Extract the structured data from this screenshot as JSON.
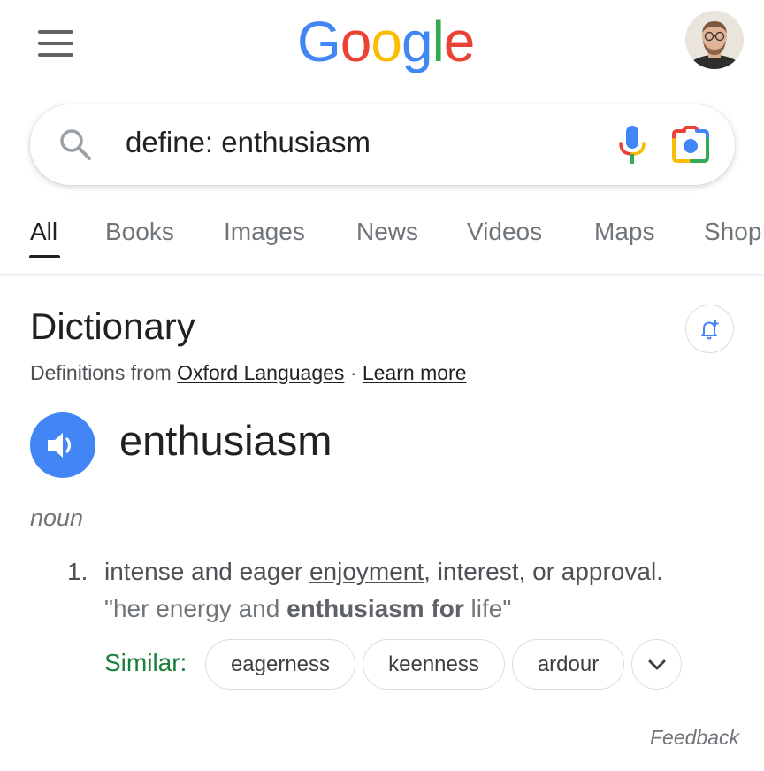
{
  "header": {
    "logo_letters": [
      {
        "char": "G",
        "color": "#4285F4"
      },
      {
        "char": "o",
        "color": "#EA4335"
      },
      {
        "char": "o",
        "color": "#FBBC05"
      },
      {
        "char": "g",
        "color": "#4285F4"
      },
      {
        "char": "l",
        "color": "#34A853"
      },
      {
        "char": "e",
        "color": "#EA4335"
      }
    ],
    "menu_icon": "hamburger-menu-icon",
    "avatar_icon": "user-avatar"
  },
  "search": {
    "query": "define: enthusiasm",
    "search_icon": "search-icon",
    "voice_icon": "microphone-icon",
    "lens_icon": "google-lens-icon"
  },
  "tabs": [
    {
      "label": "All",
      "active": true
    },
    {
      "label": "Books",
      "active": false
    },
    {
      "label": "Images",
      "active": false
    },
    {
      "label": "News",
      "active": false
    },
    {
      "label": "Videos",
      "active": false
    },
    {
      "label": "Maps",
      "active": false
    },
    {
      "label": "Shop",
      "active": false
    }
  ],
  "dictionary": {
    "title": "Dictionary",
    "source_prefix": "Definitions from",
    "source_link": "Oxford Languages",
    "separator": "·",
    "learn_more": "Learn more",
    "alert_icon": "bell-plus-icon",
    "speaker_icon": "speaker-icon",
    "word": "enthusiasm",
    "part_of_speech": "noun",
    "definitions": [
      {
        "number": "1.",
        "text_before": "intense and eager ",
        "link_word": "enjoyment",
        "text_after": ", interest, or approval.",
        "example_before": "\"her energy and ",
        "example_bold": "enthusiasm for",
        "example_after": " life\""
      }
    ],
    "similar_label": "Similar:",
    "similar_words": [
      "eagerness",
      "keenness",
      "ardour"
    ],
    "expand_icon": "chevron-down-icon"
  },
  "feedback": "Feedback",
  "colors": {
    "accent_blue": "#4285F4",
    "similar_green": "#188038",
    "text_primary": "#202124",
    "text_secondary": "#70757A"
  }
}
